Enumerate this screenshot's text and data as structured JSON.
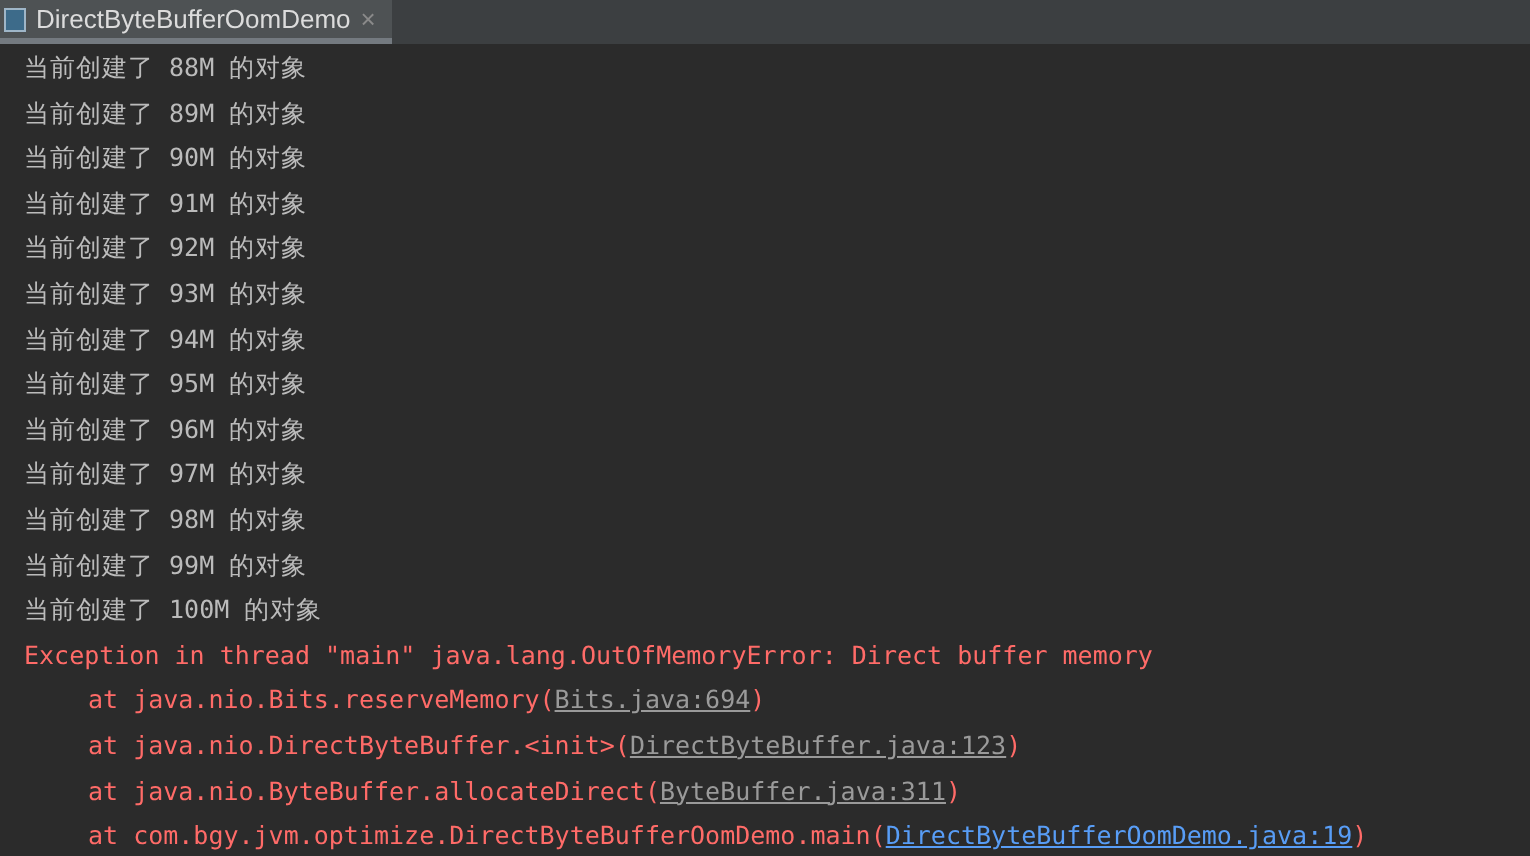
{
  "tab": {
    "title": "DirectByteBufferOomDemo",
    "close": "×",
    "selected": true
  },
  "console": [
    {
      "kind": "out",
      "text": "当前创建了 88M 的对象"
    },
    {
      "kind": "out",
      "text": "当前创建了 89M 的对象"
    },
    {
      "kind": "out",
      "text": "当前创建了 90M 的对象"
    },
    {
      "kind": "out",
      "text": "当前创建了 91M 的对象"
    },
    {
      "kind": "out",
      "text": "当前创建了 92M 的对象"
    },
    {
      "kind": "out",
      "text": "当前创建了 93M 的对象"
    },
    {
      "kind": "out",
      "text": "当前创建了 94M 的对象"
    },
    {
      "kind": "out",
      "text": "当前创建了 95M 的对象"
    },
    {
      "kind": "out",
      "text": "当前创建了 96M 的对象"
    },
    {
      "kind": "out",
      "text": "当前创建了 97M 的对象"
    },
    {
      "kind": "out",
      "text": "当前创建了 98M 的对象"
    },
    {
      "kind": "out",
      "text": "当前创建了 99M 的对象"
    },
    {
      "kind": "out",
      "text": "当前创建了 100M 的对象"
    },
    {
      "kind": "error",
      "text": "Exception in thread \"main\" java.lang.OutOfMemoryError: Direct buffer memory"
    },
    {
      "kind": "frame",
      "text": "at java.nio.Bits.reserveMemory(",
      "link": "Bits.java:694",
      "end": ")",
      "highlighted": false
    },
    {
      "kind": "frame",
      "text": "at java.nio.DirectByteBuffer.<init>(",
      "link": "DirectByteBuffer.java:123",
      "end": ")",
      "highlighted": false
    },
    {
      "kind": "frame",
      "text": "at java.nio.ByteBuffer.allocateDirect(",
      "link": "ByteBuffer.java:311",
      "end": ")",
      "highlighted": false
    },
    {
      "kind": "frame",
      "text": "at com.bgy.jvm.optimize.DirectByteBufferOomDemo.main(",
      "link": "DirectByteBufferOomDemo.java:19",
      "end": ")",
      "highlighted": true
    }
  ]
}
